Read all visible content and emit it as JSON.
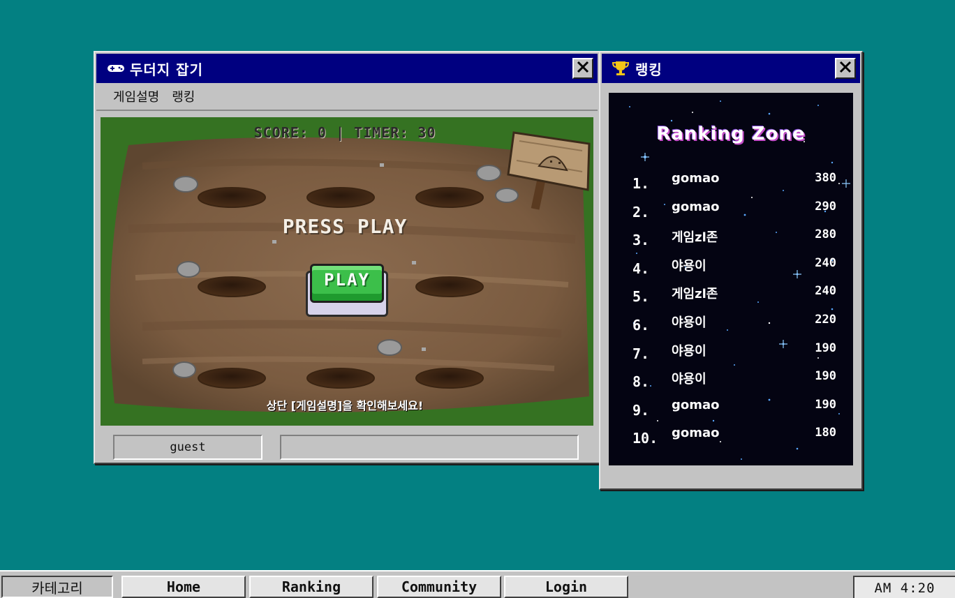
{
  "game_window": {
    "title": "두더지 잡기",
    "title_icon": "gamepad-icon",
    "menu": [
      "게임설명",
      "랭킹"
    ],
    "hud": "SCORE: 0  |  TIMER: 30",
    "press_play": "PRESS PLAY",
    "play_button": "PLAY",
    "hint": "상단 [게임설명]을 확인해보세요!",
    "username": "guest",
    "status_message": ""
  },
  "ranking_window": {
    "title": "랭킹",
    "title_icon": "trophy-icon",
    "heading": "Ranking Zone",
    "entries": [
      {
        "rank": "1.",
        "name": "gomao",
        "score": "380"
      },
      {
        "rank": "2.",
        "name": "gomao",
        "score": "290"
      },
      {
        "rank": "3.",
        "name": "게임zl존",
        "score": "280"
      },
      {
        "rank": "4.",
        "name": "야용이",
        "score": "240"
      },
      {
        "rank": "5.",
        "name": "게임zl존",
        "score": "240"
      },
      {
        "rank": "6.",
        "name": "야용이",
        "score": "220"
      },
      {
        "rank": "7.",
        "name": "야용이",
        "score": "190"
      },
      {
        "rank": "8.",
        "name": "야용이",
        "score": "190"
      },
      {
        "rank": "9.",
        "name": "gomao",
        "score": "190"
      },
      {
        "rank": "10.",
        "name": "gomao",
        "score": "180"
      }
    ]
  },
  "taskbar": {
    "category": "카테고리",
    "buttons": [
      "Home",
      "Ranking",
      "Community",
      "Login"
    ],
    "clock": "AM 4:20"
  },
  "colors": {
    "desktop": "#038082",
    "titlebar": "#000080",
    "window": "#c3c3c3",
    "play_green": "#3cbf4a"
  }
}
